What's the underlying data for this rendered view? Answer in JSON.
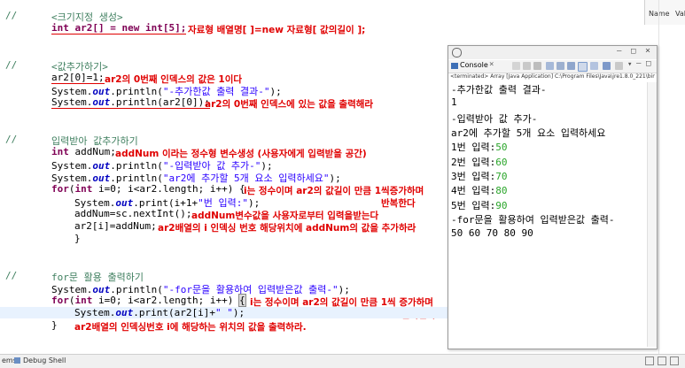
{
  "editor": {
    "lines": {
      "c1": "//",
      "c1_text": "<크기지정 생성>",
      "l1": "int ar2[] = new int[5];",
      "n1": "자료형 배열명[ ]=new 자료형[ 값의길이 ];",
      "c2": "//",
      "c2_text": "<값추가하기>",
      "l2": "ar2[0]=1;",
      "n2": "ar2의 0번째 인덱스의 값은 1이다",
      "l3_a": "System.",
      "l3_out": "out",
      "l3_b": ".println(",
      "l3_s": "\"-추가한값 출력 결과-\"",
      "l3_c": ");",
      "l4_a": "System.",
      "l4_out": "out",
      "l4_b": ".println(ar2[0]);",
      "n4": "ar2의 0번째 인덱스에 있는 값을 출력해라",
      "c3": "//",
      "c3_text": "입력받아 값추가하기",
      "l5_kw": "int",
      "l5_b": " addNum;",
      "n5": "addNum 이라는 정수형 변수생성 (사용자에게 입력받을 공간)",
      "l6_a": "System.",
      "l6_out": "out",
      "l6_b": ".println(",
      "l6_s": "\"-입력받아 값 추가-\"",
      "l6_c": ");",
      "l7_a": "System.",
      "l7_out": "out",
      "l7_b": ".println(",
      "l7_s": "\"ar2에 추가할 5개 요소 입력하세요\"",
      "l7_c": ");",
      "l8_kw1": "for",
      "l8_b": "(",
      "l8_kw2": "int",
      "l8_c": " i=0; i<ar2.length; i++) {",
      "n8": "i는 정수이며 ar2의 값길이 만큼 1씩증가하며",
      "n8b": "반복한다",
      "l9_a": "System.",
      "l9_out": "out",
      "l9_b": ".print(i+1+",
      "l9_s": "\"번 입력:\"",
      "l9_c": ");",
      "l10": "addNum=sc.nextInt();",
      "n10": "addNum변수값을 사용자로부터 입력을받는다",
      "l11": "ar2[i]=addNum;",
      "n11": "ar2배열의 i 인덱싱 번호 해당위치에 addNum의 값을 추가하라",
      "l12": "}",
      "c4": "//",
      "c4_text": "for문 활용 출력하기",
      "l13_a": "System.",
      "l13_out": "out",
      "l13_b": ".println(",
      "l13_s": "\"-for문을 활용하여 입력받은값 출력-\"",
      "l13_c": ");",
      "l14_kw1": "for",
      "l14_b": "(",
      "l14_kw2": "int",
      "l14_c": " i=0; i<ar2.length; i++) ",
      "l14_br": "{",
      "n14": "i는 정수이며 ar2의 값길이 만큼 1씩 증가하며",
      "n14b": "반복한다.",
      "l15_a": "System.",
      "l15_out": "out",
      "l15_b": ".print(ar2[i]+",
      "l15_s": "\" \"",
      "l15_c": ");",
      "l16": "}",
      "n16": "ar2배열의 인덱싱번호 i에 해당하는 위치의 값을 출력하라."
    }
  },
  "outline": {
    "name_col": "Name",
    "value_col": "Valu"
  },
  "console": {
    "tab_label": "Console",
    "info": "<terminated> Array [Java Application] C:\\Program Files\\Java\\jre1.8.0_221\\bin\\javaw.exe",
    "lines": [
      "-추가한값 출력 결과-",
      "1",
      "-입력받아 값 추가-",
      "ar2에 추가할 5개 요소 입력하세요",
      "1번 입력:",
      "2번 입력:",
      "3번 입력:",
      "4번 입력:",
      "5번 입력:",
      "-for문을 활용하여 입력받은값 출력-",
      "50 60 70 80 90"
    ],
    "inputs": [
      "50",
      "60",
      "70",
      "80",
      "90"
    ]
  },
  "statusbar": {
    "left_label": "ems",
    "tab_label": "Debug Shell"
  },
  "colors": {
    "comment": "#3f7f5f",
    "keyword": "#7f0055",
    "string": "#2a00ff",
    "field": "#0000c0",
    "annotation": "#e00000",
    "console_input": "#2aa52a"
  }
}
